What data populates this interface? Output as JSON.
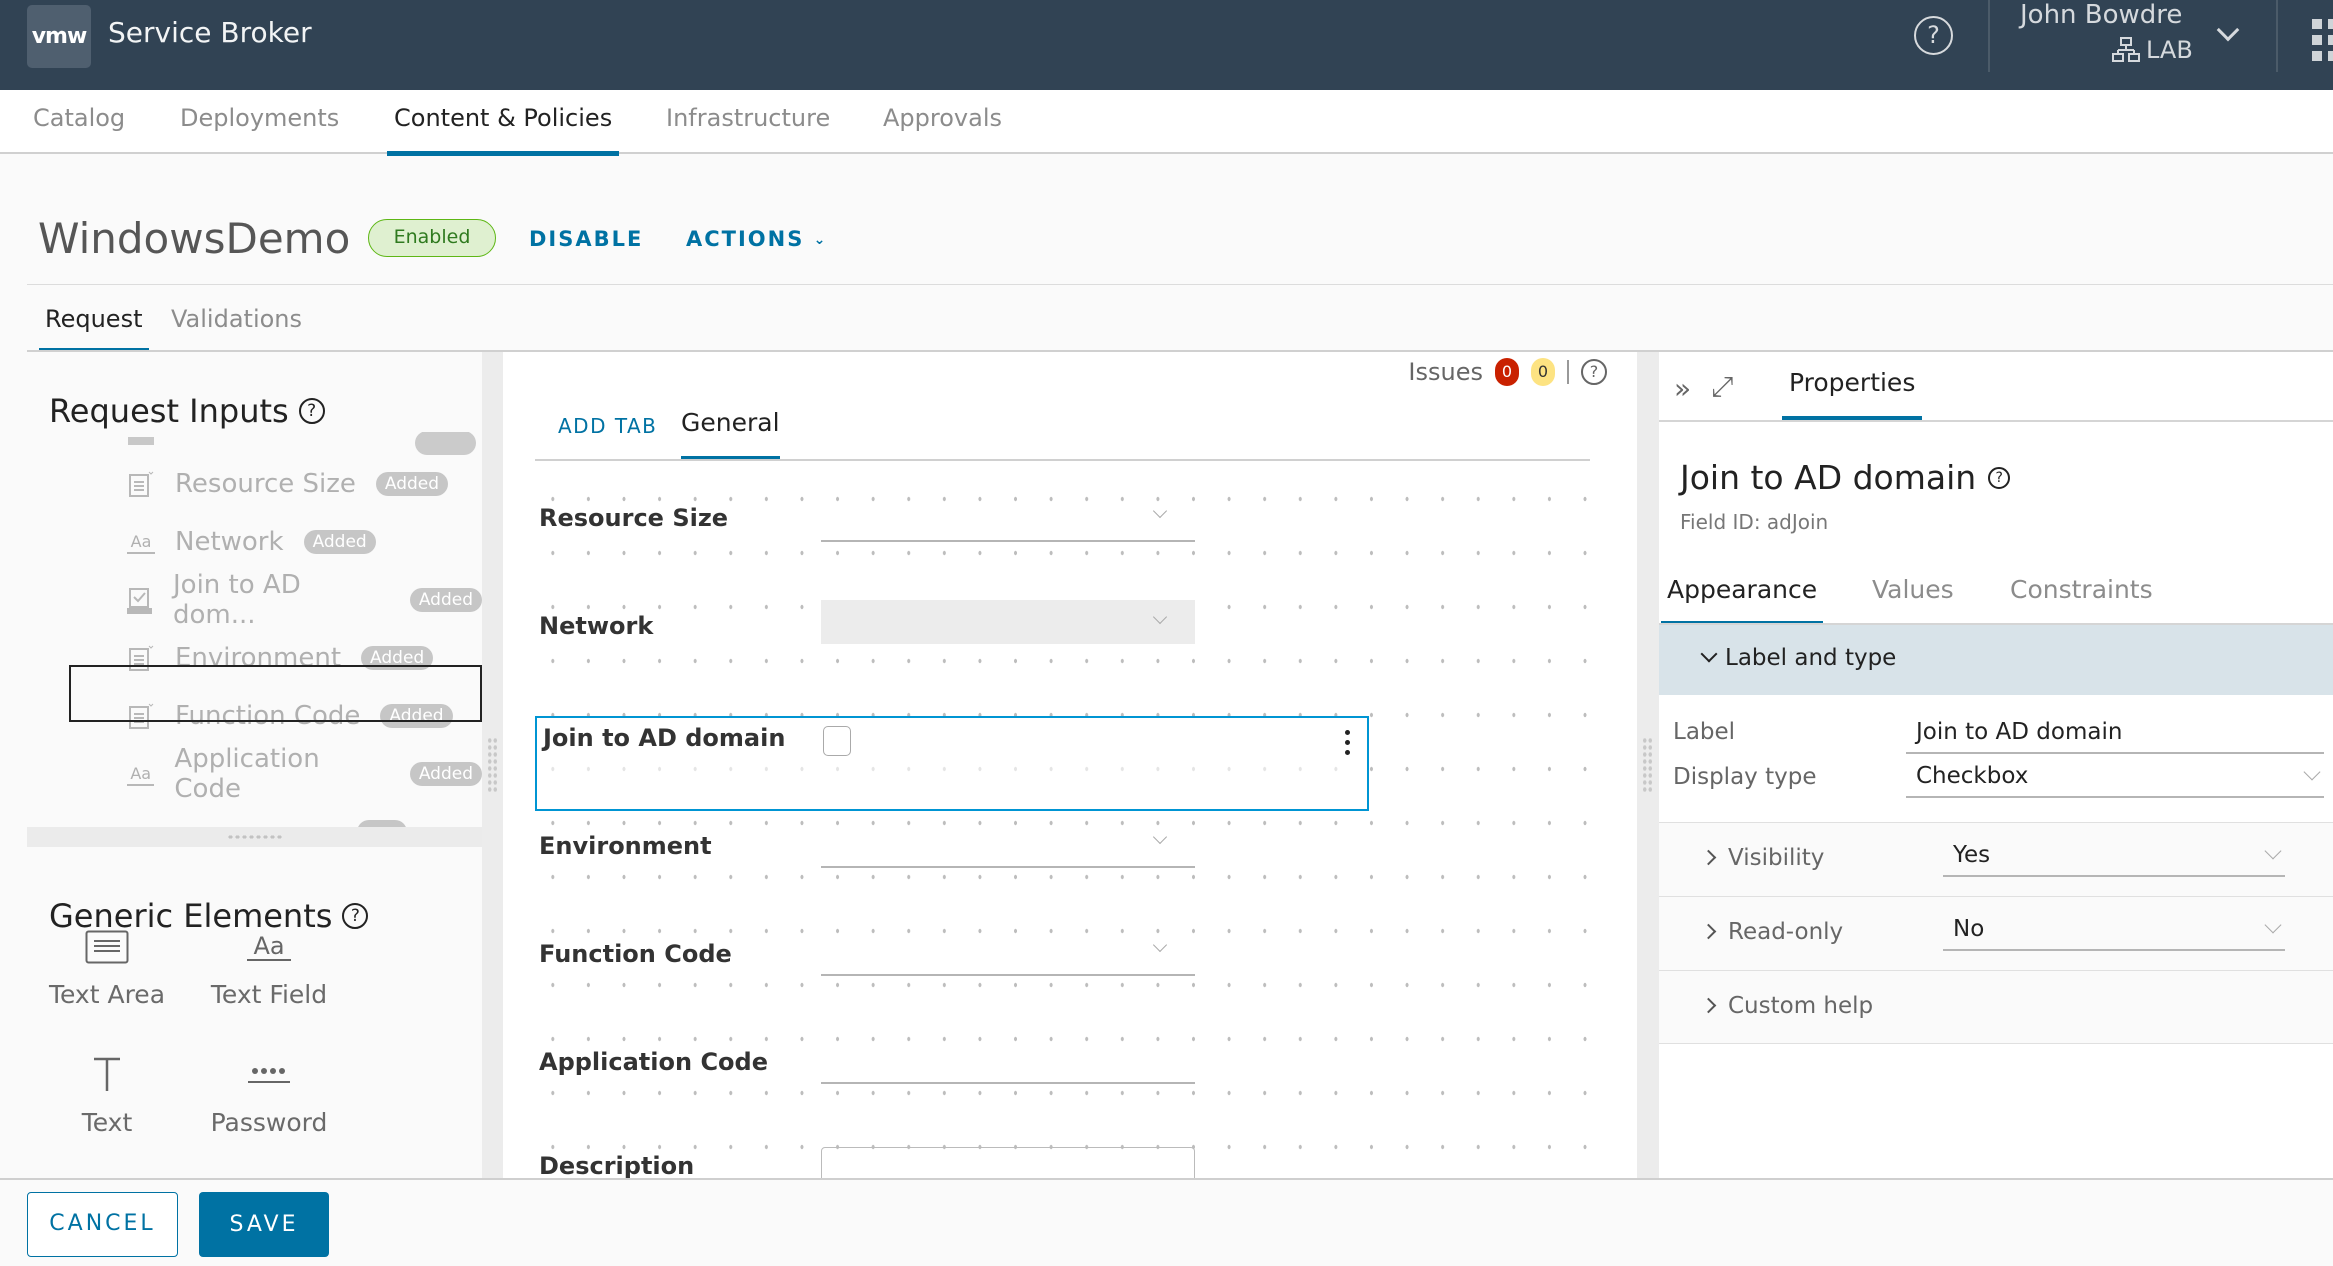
{
  "header": {
    "logo": "vmw",
    "app_title": "Service Broker",
    "user_name": "John Bowdre",
    "org_name": "LAB",
    "icons": [
      "help-icon",
      "org-icon",
      "chevron-down-icon",
      "apps-grid-icon"
    ],
    "colors": {
      "background": "#314354",
      "accent": "#0072a3"
    }
  },
  "nav": {
    "items": [
      {
        "label": "Catalog",
        "active": false
      },
      {
        "label": "Deployments",
        "active": false
      },
      {
        "label": "Content & Policies",
        "active": true
      },
      {
        "label": "Infrastructure",
        "active": false
      },
      {
        "label": "Approvals",
        "active": false
      }
    ]
  },
  "page": {
    "title": "WindowsDemo",
    "status": "Enabled",
    "disable_label": "DISABLE",
    "actions_label": "ACTIONS",
    "tabs": [
      {
        "label": "Request",
        "active": true
      },
      {
        "label": "Validations",
        "active": false
      }
    ]
  },
  "left_panel": {
    "request_inputs_title": "Request Inputs",
    "inputs": [
      {
        "label": "Resource Size",
        "icon": "dropdown-icon",
        "badge": "Added"
      },
      {
        "label": "Network",
        "icon": "text-field-icon",
        "badge": "Added"
      },
      {
        "label": "Join to AD dom...",
        "icon": "checkbox-icon",
        "badge": "Added",
        "selected": true
      },
      {
        "label": "Environment",
        "icon": "dropdown-icon",
        "badge": "Added"
      },
      {
        "label": "Function Code",
        "icon": "dropdown-icon",
        "badge": "Added"
      },
      {
        "label": "Application Code",
        "icon": "text-field-icon",
        "badge": "Added"
      }
    ],
    "generic_title": "Generic Elements",
    "generic_elements": [
      {
        "label": "Text Area",
        "icon": "text-area-icon"
      },
      {
        "label": "Text Field",
        "icon": "text-field-icon"
      },
      {
        "label": "Text",
        "icon": "text-icon"
      },
      {
        "label": "Password",
        "icon": "password-icon"
      }
    ]
  },
  "canvas": {
    "issues_label": "Issues",
    "errors": "0",
    "warnings": "0",
    "add_tab_label": "ADD TAB",
    "active_tab": "General",
    "fields": [
      {
        "label": "Resource Size",
        "type": "dropdown"
      },
      {
        "label": "Network",
        "type": "dropdown-disabled"
      },
      {
        "label": "Join to AD domain",
        "type": "checkbox",
        "selected": true,
        "checked": false
      },
      {
        "label": "Environment",
        "type": "dropdown"
      },
      {
        "label": "Function Code",
        "type": "dropdown"
      },
      {
        "label": "Application Code",
        "type": "text"
      },
      {
        "label": "Description",
        "type": "textarea"
      }
    ]
  },
  "properties": {
    "tab_label": "Properties",
    "field_title": "Join to AD domain",
    "field_id": "Field ID: adJoin",
    "tabs": [
      {
        "label": "Appearance",
        "active": true
      },
      {
        "label": "Values",
        "active": false
      },
      {
        "label": "Constraints",
        "active": false
      }
    ],
    "section_label": "Label and type",
    "label_caption": "Label",
    "label_value": "Join to AD domain",
    "display_type_caption": "Display type",
    "display_type_value": "Checkbox",
    "visibility_caption": "Visibility",
    "visibility_value": "Yes",
    "readonly_caption": "Read-only",
    "readonly_value": "No",
    "custom_help_caption": "Custom help"
  },
  "footer": {
    "cancel_label": "CANCEL",
    "save_label": "SAVE"
  }
}
